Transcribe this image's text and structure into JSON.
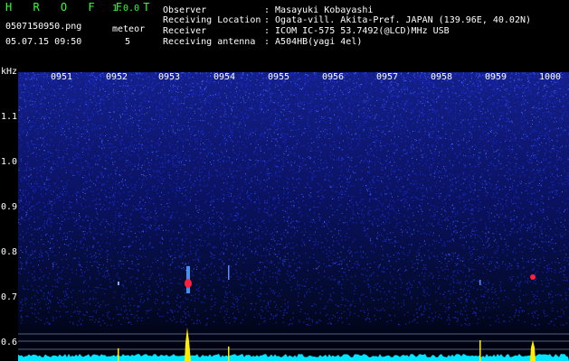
{
  "header": {
    "logo_letters": "H R O F F T",
    "version": "1.0.0",
    "filename": "0507150950.png",
    "datetime": "05.07.15 09:50",
    "meteor_label": "meteor",
    "meteor_count": "5"
  },
  "info": [
    {
      "label": "Observer",
      "value": ": Masayuki Kobayashi"
    },
    {
      "label": "Receiving Location",
      "value": ": Ogata-vill. Akita-Pref. JAPAN (139.96E, 40.02N)"
    },
    {
      "label": "Receiver",
      "value": ": ICOM IC-575 53.7492(@LCD)MHz USB"
    },
    {
      "label": "Receiving antenna",
      "value": ": A504HB(yagi 4el)"
    }
  ],
  "axis": {
    "unit": "kHz",
    "y_ticks": [
      "1.1",
      "1.0",
      "0.9",
      "0.8",
      "0.7",
      "0.6"
    ],
    "time_ticks": [
      "0951",
      "0952",
      "0953",
      "0954",
      "0955",
      "0956",
      "0957",
      "0958",
      "0959",
      "1000"
    ]
  },
  "colors": {
    "header_text": "#ffffff",
    "title_green": "#33ff33",
    "background": "#000000",
    "noise_blue": "#1a2bd6",
    "baseline_cyan": "#00e5ff",
    "meteor_yellow": "#ffee00",
    "meteor_red": "#ff2040"
  }
}
